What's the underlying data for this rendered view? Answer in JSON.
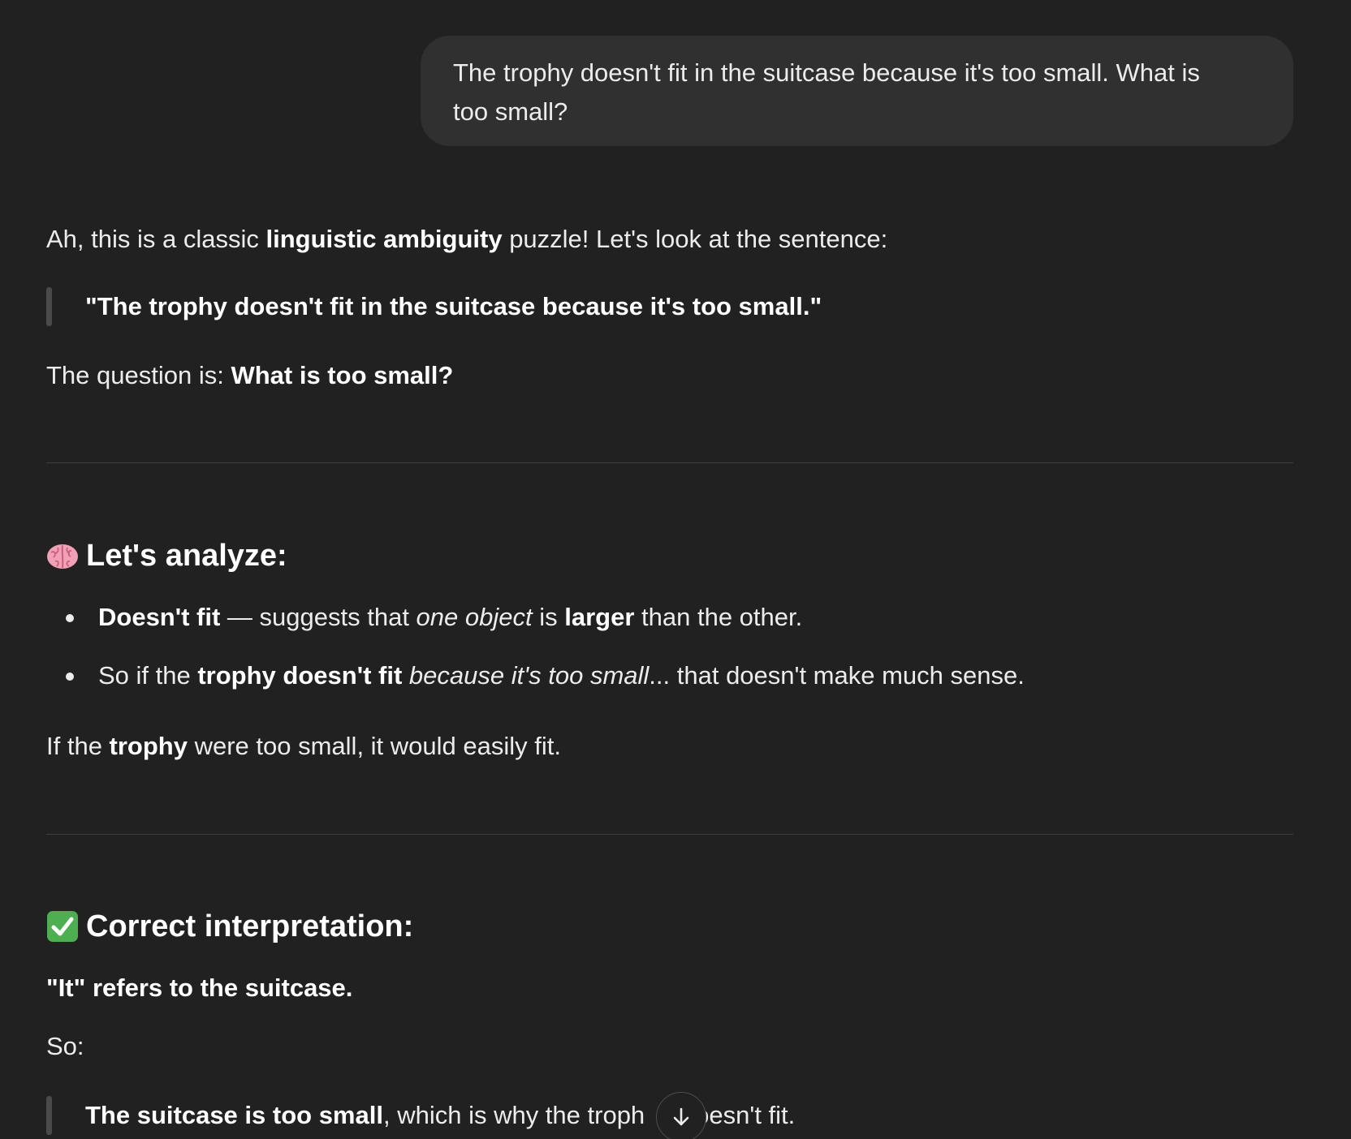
{
  "user_message": {
    "line1": "The trophy doesn't fit in the suitcase because it's too small. What is",
    "line2": "too small?"
  },
  "assistant": {
    "intro": {
      "pre": "Ah, this is a classic ",
      "bold": "linguistic ambiguity",
      "post": " puzzle! Let's look at the sentence:"
    },
    "quote1": "\"The trophy doesn't fit in the suitcase because it's too small.\"",
    "question": {
      "pre": "The question is: ",
      "bold": "What is too small?"
    },
    "section1": {
      "icon": "brain-emoji",
      "title": "Let's analyze:",
      "bullets": [
        {
          "b1": "Doesn't fit",
          "t1": " — suggests that ",
          "i1": "one object",
          "t2": " is ",
          "b2": "larger",
          "t3": " than the other."
        },
        {
          "t1": "So if the ",
          "b1": "trophy doesn't fit",
          "t2": " ",
          "i1": "because it's too small",
          "t3": "... that doesn't make much sense."
        }
      ],
      "after": {
        "pre": "If the ",
        "bold": "trophy",
        "post": " were too small, it would easily fit."
      }
    },
    "section2": {
      "icon": "check-mark-emoji",
      "title": "Correct interpretation:",
      "bold_line": "\"It\" refers to the suitcase.",
      "so": "So:",
      "quote": {
        "bold": "The suitcase is too small",
        "post": ", which is why the troph",
        "tail": "oesn't fit."
      }
    }
  },
  "scroll_button": {
    "icon": "arrow-down-icon"
  }
}
